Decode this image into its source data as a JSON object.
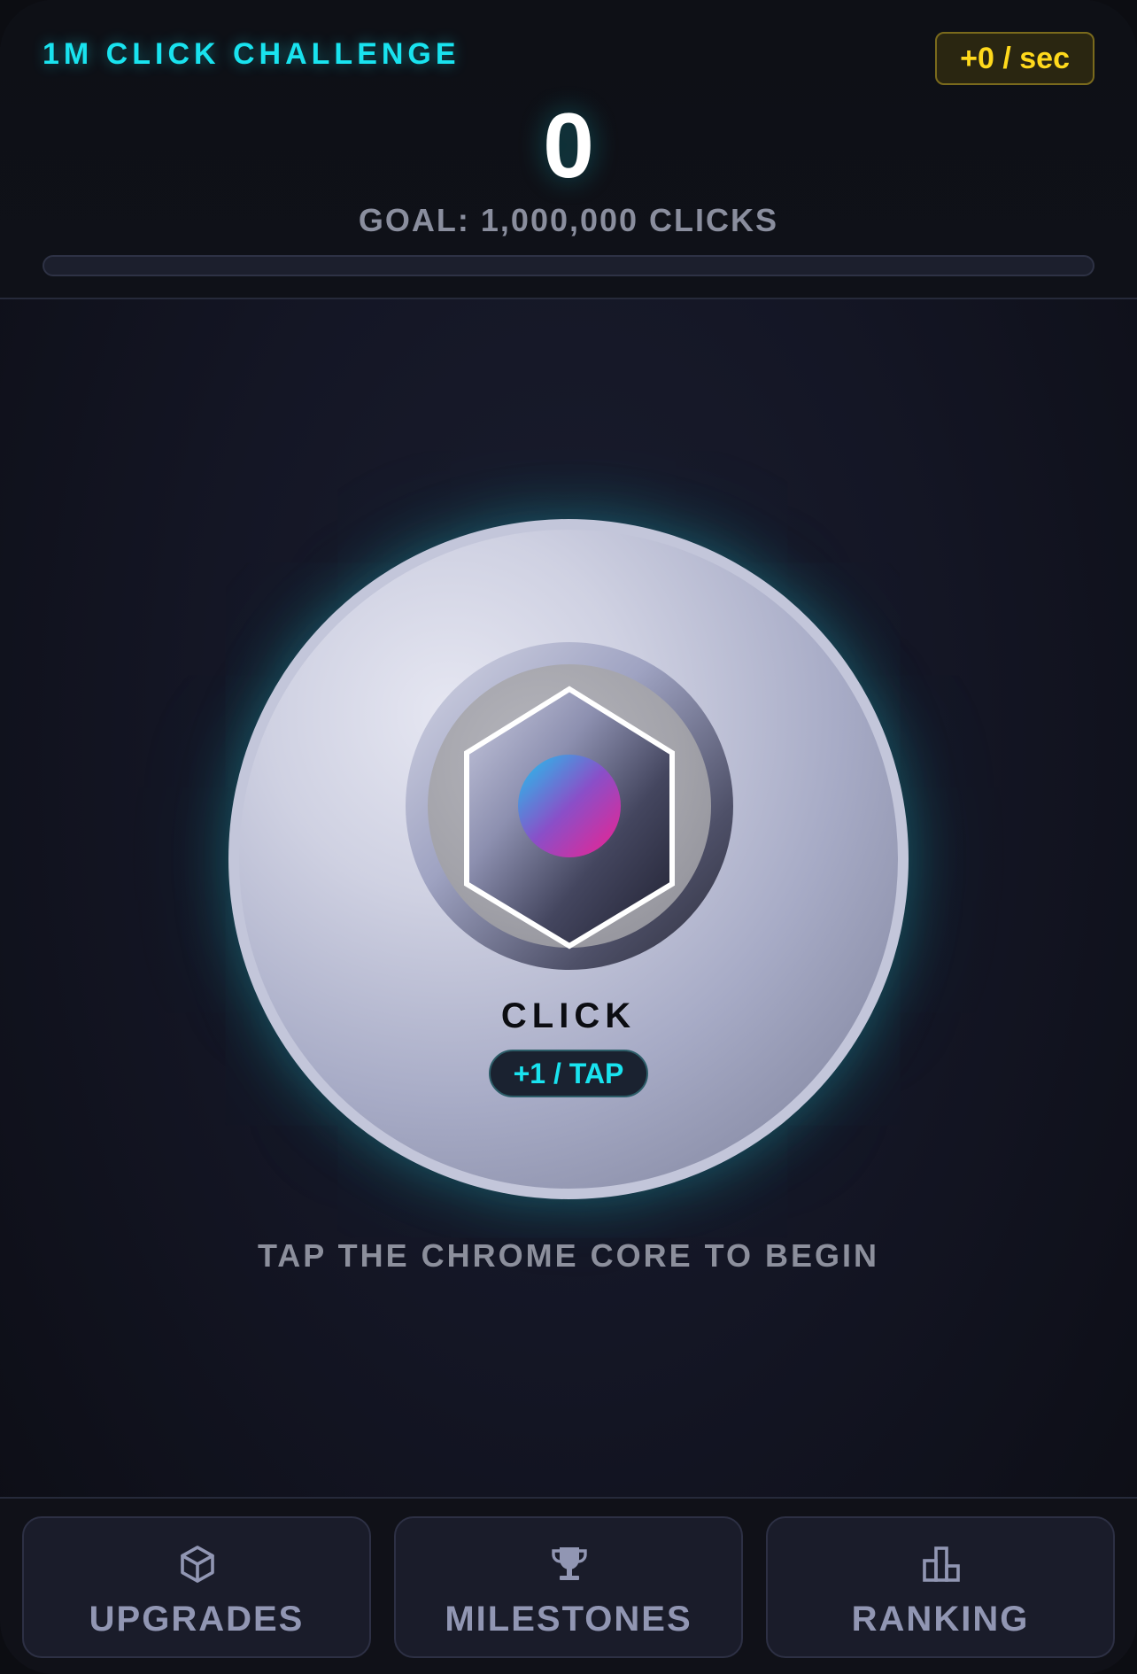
{
  "header": {
    "title": "1M CLICK CHALLENGE",
    "rate": "+0 / sec",
    "count": "0",
    "goal": "GOAL: 1,000,000 CLICKS",
    "progress_fraction": 0
  },
  "core": {
    "label": "CLICK",
    "per_tap": "+1 / TAP"
  },
  "hint": "TAP THE CHROME CORE TO BEGIN",
  "nav": {
    "items": [
      {
        "label": "UPGRADES",
        "icon": "cube-icon"
      },
      {
        "label": "MILESTONES",
        "icon": "trophy-icon"
      },
      {
        "label": "RANKING",
        "icon": "podium-icon"
      }
    ]
  },
  "colors": {
    "accent_cyan": "#19e3ef",
    "accent_yellow": "#ffd91c",
    "accent_magenta": "#e2219a",
    "nav_text": "#9196b3"
  }
}
